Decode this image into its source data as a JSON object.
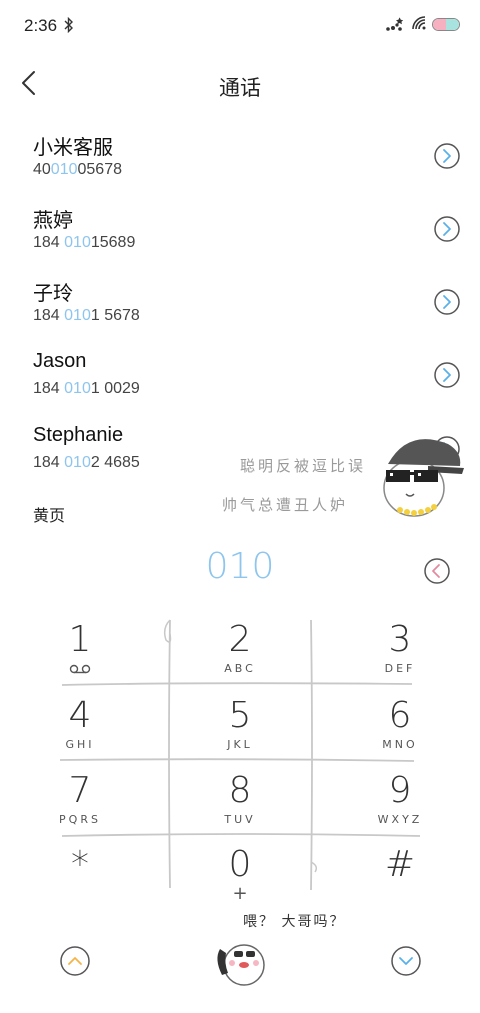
{
  "status_bar": {
    "time": "2:36"
  },
  "header": {
    "title": "通话"
  },
  "contacts": [
    {
      "name": "小米客服",
      "num_pre": "40",
      "num_hl": "010",
      "num_post": "05678"
    },
    {
      "name": "燕婷",
      "num_pre": "184 ",
      "num_hl": "010",
      "num_post": "15689"
    },
    {
      "name": "子玲",
      "num_pre": "184 ",
      "num_hl": "010",
      "num_post": "1 5678"
    },
    {
      "name": "Jason",
      "num_pre": "184 ",
      "num_hl": "010",
      "num_post": "1 0029"
    },
    {
      "name": "Stephanie",
      "num_pre": "184 ",
      "num_hl": "010",
      "num_post": "2 4685"
    }
  ],
  "yellow_pages": "黄页",
  "sticker_text": {
    "line1": "聪明反被逗比误",
    "line2": "帅气总遭丑人妒"
  },
  "dial": {
    "digits": "010"
  },
  "keypad": [
    {
      "digit": "1",
      "letters": ""
    },
    {
      "digit": "2",
      "letters": "ABC"
    },
    {
      "digit": "3",
      "letters": "DEF"
    },
    {
      "digit": "4",
      "letters": "GHI"
    },
    {
      "digit": "5",
      "letters": "JKL"
    },
    {
      "digit": "6",
      "letters": "MNO"
    },
    {
      "digit": "7",
      "letters": "PQRS"
    },
    {
      "digit": "8",
      "letters": "TUV"
    },
    {
      "digit": "9",
      "letters": "WXYZ"
    },
    {
      "digit": "*",
      "letters": ""
    },
    {
      "digit": "0",
      "letters": "+"
    },
    {
      "digit": "#",
      "letters": ""
    }
  ],
  "bottom": {
    "hello_text": "喂？ 大哥吗？"
  },
  "colors": {
    "accent_blue": "#8ec5ee",
    "accent_orange": "#f5b347",
    "accent_pink": "#e48aa0"
  }
}
